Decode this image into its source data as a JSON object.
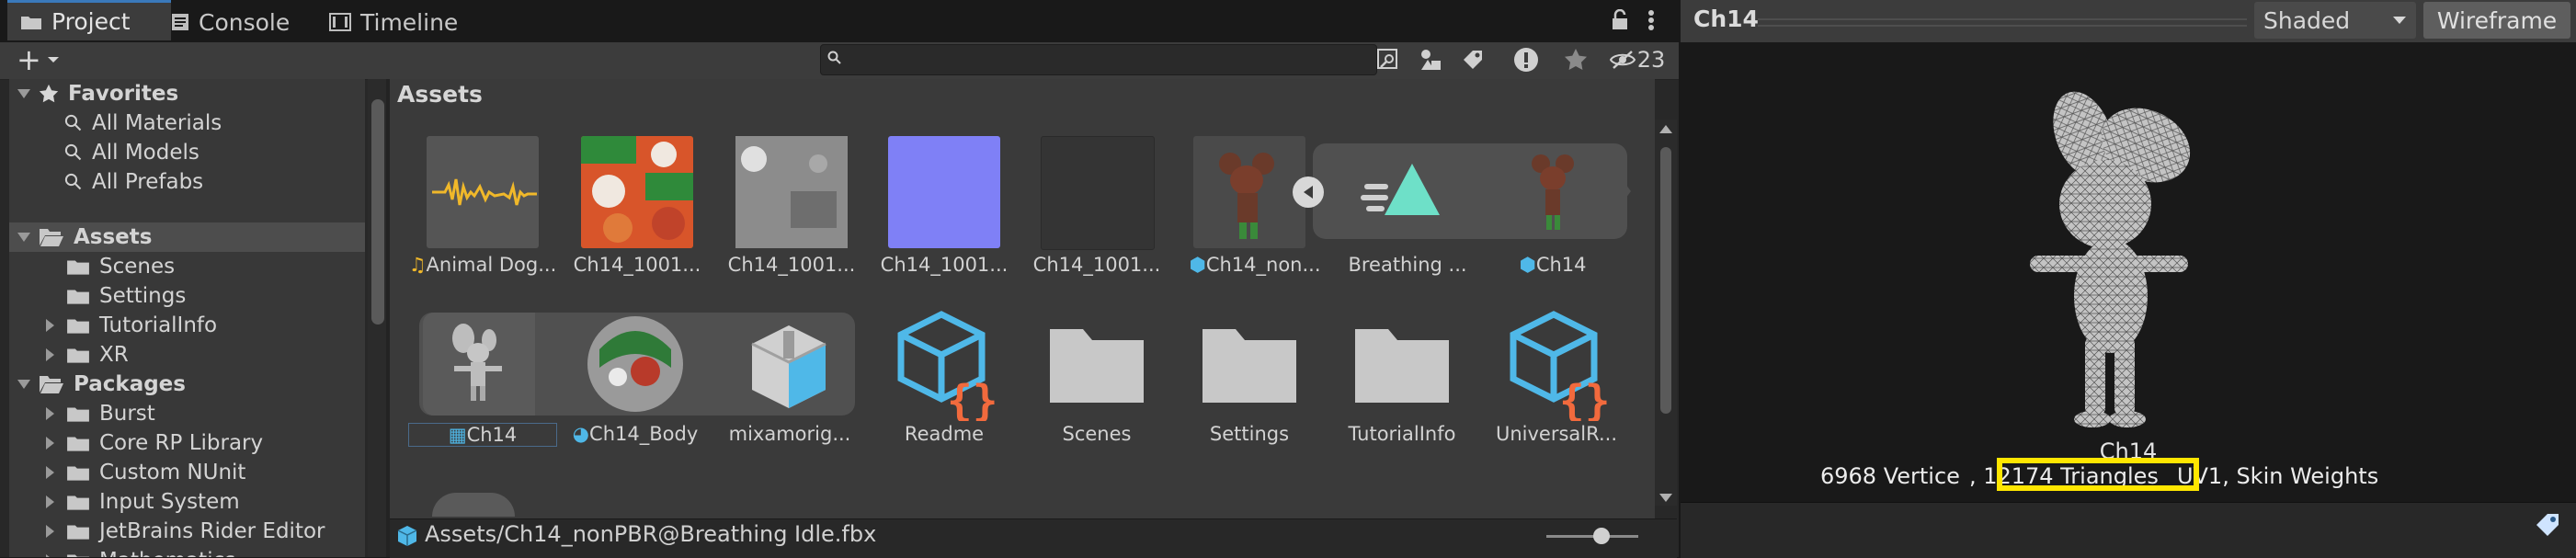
{
  "tabs": {
    "project": "Project",
    "console": "Console",
    "timeline": "Timeline"
  },
  "toolbar": {
    "add_label": "+",
    "hidden_count": "23",
    "search_placeholder": ""
  },
  "tree": {
    "favorites": "Favorites",
    "fav_items": [
      "All Materials",
      "All Models",
      "All Prefabs"
    ],
    "assets": "Assets",
    "assets_items": [
      "Scenes",
      "Settings",
      "TutorialInfo",
      "XR"
    ],
    "packages": "Packages",
    "package_items": [
      "Burst",
      "Core RP Library",
      "Custom NUnit",
      "Input System",
      "JetBrains Rider Editor",
      "Mathematics"
    ]
  },
  "grid": {
    "breadcrumb": "Assets",
    "row1": [
      "Animal Dog...",
      "Ch14_1001...",
      "Ch14_1001...",
      "Ch14_1001...",
      "Ch14_1001...",
      "Ch14_non...",
      "Breathing ...",
      "Ch14"
    ],
    "row2": [
      "Ch14",
      "Ch14_Body",
      "mixamorig...",
      "Readme",
      "Scenes",
      "Settings",
      "TutorialInfo",
      "UniversalR..."
    ]
  },
  "status": {
    "path": "Assets/Ch14_nonPBR@Breathing Idle.fbx",
    "zoom": 0.6
  },
  "preview": {
    "title": "Ch14",
    "shading": "Shaded",
    "wireframe": "Wireframe",
    "model_name": "Ch14",
    "stats_vertices": "6968 Vertice",
    "stats_triangles": ", 12174 Triangles",
    "stats_rest": "UV1, Skin Weights"
  },
  "colors": {
    "accent": "#3a79bb",
    "highlight": "#ffe600",
    "script_orange": "#f26a3d",
    "script_blue": "#4fb8e8",
    "animation_teal": "#6ee0c8"
  }
}
